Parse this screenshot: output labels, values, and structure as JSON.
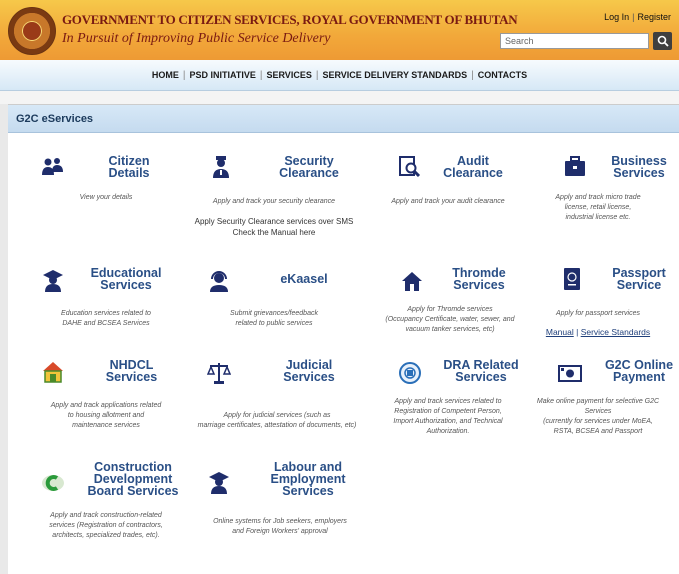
{
  "header": {
    "title": "GOVERNMENT TO CITIZEN SERVICES, ROYAL GOVERNMENT OF BHUTAN",
    "subtitle": "In Pursuit of Improving Public Service Delivery",
    "login": "Log In",
    "register": "Register",
    "search_placeholder": "Search",
    "search_icon": "magnifier-icon",
    "logo_icon": "bhutan-emblem-icon"
  },
  "nav": {
    "items": [
      "HOME",
      "PSD INITIATIVE",
      "SERVICES",
      "SERVICE DELIVERY STANDARDS",
      "CONTACTS"
    ]
  },
  "section": {
    "title": "G2C eServices"
  },
  "colors": {
    "header_gold": "#f2a83a",
    "title_maroon": "#7a1a12",
    "link_blue": "#2a4f86",
    "icon_navy": "#1f2d6b"
  },
  "services": [
    {
      "id": "citizen",
      "title1": "Citizen",
      "title2": "Details",
      "desc": "View your details",
      "icon": "users-icon"
    },
    {
      "id": "security",
      "title1": "Security",
      "title2": "Clearance",
      "desc": "Apply and track your security clearance",
      "extra1": "Apply Security Clearance services over SMS",
      "extra2": "Check the Manual here",
      "icon": "officer-icon"
    },
    {
      "id": "audit",
      "title1": "Audit",
      "title2": "Clearance",
      "desc": "Apply and track your audit clearance",
      "icon": "audit-search-icon"
    },
    {
      "id": "business",
      "title1": "Business",
      "title2": "Services",
      "desc1": "Apply and track micro trade",
      "desc2": "license, retail license,",
      "desc3": "industrial license etc.",
      "icon": "briefcase-icon"
    },
    {
      "id": "education",
      "title1": "Educational",
      "title2": "Services",
      "desc1": "Education services related to",
      "desc2": "DAHE and BCSEA Services",
      "icon": "graduate-icon"
    },
    {
      "id": "ekaasel",
      "title1": "eKaasel",
      "desc1": "Submit grievances/feedback",
      "desc2": "related to public services",
      "icon": "headset-icon"
    },
    {
      "id": "thromde",
      "title1": "Thromde",
      "title2": "Services",
      "desc1": "Apply for Thromde services",
      "desc2": "(Occupancy Certificate, water, sewer, and",
      "desc3": "vacuum tanker services, etc)",
      "icon": "house-icon"
    },
    {
      "id": "passport",
      "title1": "Passport",
      "title2": "Service",
      "desc": "Apply for passport services",
      "link1": "Manual",
      "link2": "Service Standards",
      "icon": "passport-icon"
    },
    {
      "id": "nhdcl",
      "title1": "NHDCL",
      "title2": "Services",
      "desc1": "Apply and track applications related",
      "desc2": "to housing allotment and",
      "desc3": "maintenance services",
      "icon": "nhdcl-house-icon"
    },
    {
      "id": "judicial",
      "title1": "Judicial",
      "title2": "Services",
      "desc1": "Apply for judicial services (such as",
      "desc2": "marriage certificates, attestation of documents, etc)",
      "icon": "scales-icon"
    },
    {
      "id": "dra",
      "title1": "DRA Related",
      "title2": "Services",
      "desc1": "Apply and track services related to",
      "desc2": "Registration of Competent Person,",
      "desc3": "Import Authorization, and Technical",
      "desc4": "Authorization.",
      "icon": "dra-logo-icon"
    },
    {
      "id": "payment",
      "title1": "G2C Online",
      "title2": "Payment",
      "desc1": "Make online payment for selective G2C",
      "desc2": "Services",
      "desc3": "(currently for services under MoEA,",
      "desc4": "RSTA, BCSEA and Passport",
      "icon": "payment-icon"
    },
    {
      "id": "construction",
      "title1": "Construction",
      "title2": "Development",
      "title3": "Board Services",
      "desc1": "Apply and track construction-related",
      "desc2": "services (Registration of contractors,",
      "desc3": "architects, specialized trades, etc).",
      "icon": "cdb-logo-icon"
    },
    {
      "id": "labour",
      "title1": "Labour and",
      "title2": "Employment",
      "title3": "Services",
      "desc1": "Online systems for Job seekers, employers",
      "desc2": "and Foreign Workers' approval",
      "icon": "worker-icon"
    }
  ]
}
